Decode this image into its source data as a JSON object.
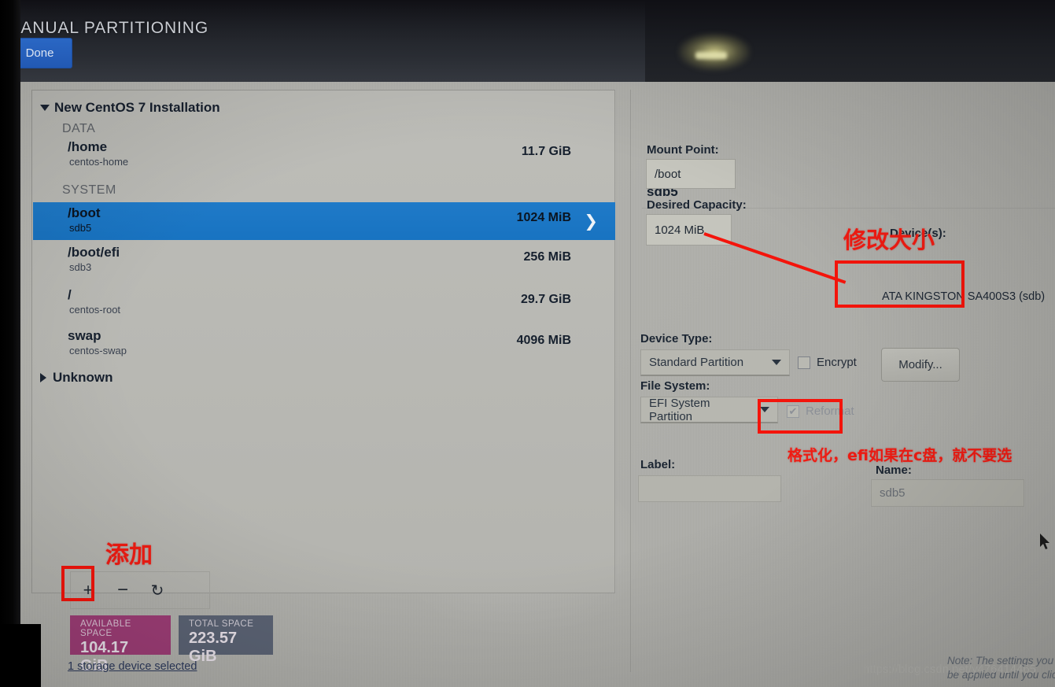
{
  "header": {
    "title": "MANUAL PARTITIONING",
    "done_label": "Done"
  },
  "left_panel": {
    "root_label": "New CentOS 7 Installation",
    "groups": [
      {
        "name": "DATA"
      },
      {
        "name": "SYSTEM"
      }
    ],
    "partitions": [
      {
        "mount": "/home",
        "device": "centos-home",
        "size": "11.7 GiB",
        "selected": false
      },
      {
        "mount": "/boot",
        "device": "sdb5",
        "size": "1024 MiB",
        "selected": true
      },
      {
        "mount": "/boot/efi",
        "device": "sdb3",
        "size": "256 MiB",
        "selected": false
      },
      {
        "mount": "/",
        "device": "centos-root",
        "size": "29.7 GiB",
        "selected": false
      },
      {
        "mount": "swap",
        "device": "centos-swap",
        "size": "4096 MiB",
        "selected": false
      }
    ],
    "unknown_label": "Unknown",
    "toolbar": {
      "add_icon": "plus-icon",
      "remove_icon": "minus-icon",
      "refresh_icon": "refresh-icon",
      "add_glyph": "+",
      "remove_glyph": "−",
      "refresh_glyph": "↻"
    },
    "available_space": {
      "caption": "AVAILABLE SPACE",
      "value": "104.17 GiB",
      "color": "#9d3d76"
    },
    "total_space": {
      "caption": "TOTAL SPACE",
      "value": "223.57 GiB",
      "color": "#5b6374"
    },
    "storage_link": "1 storage device selected"
  },
  "right_panel": {
    "title": "sdb5",
    "mount_point": {
      "label": "Mount Point:",
      "value": "/boot"
    },
    "desired_capacity": {
      "label": "Desired Capacity:",
      "value": "1024 MiB"
    },
    "devices": {
      "label": "Device(s):",
      "value": "ATA KINGSTON SA400S3 (sdb)"
    },
    "modify_button": "Modify...",
    "device_type": {
      "label": "Device Type:",
      "value": "Standard Partition"
    },
    "encrypt": {
      "label": "Encrypt",
      "checked": false
    },
    "file_system": {
      "label": "File System:",
      "value": "EFI System Partition"
    },
    "reformat": {
      "label": "Reformat",
      "checked": true,
      "disabled": true,
      "glyph": "✔"
    },
    "label_field": {
      "label": "Label:",
      "value": ""
    },
    "name_field": {
      "label": "Name:",
      "value": "sdb5"
    },
    "note_line1": "Note:  The settings you m",
    "note_line2": "be applied until you click"
  },
  "annotations": {
    "add": "添加",
    "modify_size": "修改大小",
    "reformat_note": "格式化，efi如果在c盘，就不要选",
    "color": "#f4140b"
  },
  "watermark": "https://blog.csdn.net/y476414465"
}
